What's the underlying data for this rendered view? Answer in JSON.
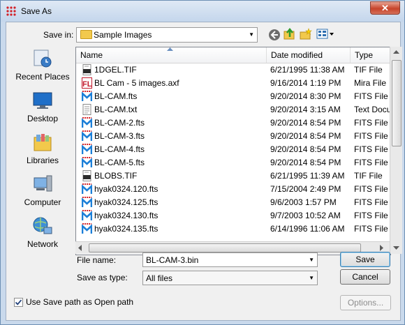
{
  "window": {
    "title": "Save As",
    "close_glyph": "✕"
  },
  "save_in": {
    "label": "Save in:",
    "value": "Sample Images"
  },
  "places": [
    {
      "label": "Recent Places",
      "icon": "recent-places-icon"
    },
    {
      "label": "Desktop",
      "icon": "desktop-icon"
    },
    {
      "label": "Libraries",
      "icon": "libraries-icon"
    },
    {
      "label": "Computer",
      "icon": "computer-icon"
    },
    {
      "label": "Network",
      "icon": "network-icon"
    }
  ],
  "columns": {
    "name": "Name",
    "date": "Date modified",
    "type": "Type"
  },
  "files": [
    {
      "name": "1DGEL.TIF",
      "date": "6/21/1995 11:38 AM",
      "type": "TIF File",
      "icon": "tif"
    },
    {
      "name": "BL Cam - 5 images.axf",
      "date": "9/16/2014 1:19 PM",
      "type": "Mira File",
      "icon": "axf"
    },
    {
      "name": "BL-CAM.fts",
      "date": "9/20/2014 8:30 PM",
      "type": "FITS File",
      "icon": "fits"
    },
    {
      "name": "BL-CAM.txt",
      "date": "9/20/2014 3:15 AM",
      "type": "Text Document",
      "icon": "txt"
    },
    {
      "name": "BL-CAM-2.fts",
      "date": "9/20/2014 8:54 PM",
      "type": "FITS File",
      "icon": "fits"
    },
    {
      "name": "BL-CAM-3.fts",
      "date": "9/20/2014 8:54 PM",
      "type": "FITS File",
      "icon": "fits"
    },
    {
      "name": "BL-CAM-4.fts",
      "date": "9/20/2014 8:54 PM",
      "type": "FITS File",
      "icon": "fits"
    },
    {
      "name": "BL-CAM-5.fts",
      "date": "9/20/2014 8:54 PM",
      "type": "FITS File",
      "icon": "fits"
    },
    {
      "name": "BLOBS.TIF",
      "date": "6/21/1995 11:39 AM",
      "type": "TIF File",
      "icon": "tif"
    },
    {
      "name": "hyak0324.120.fts",
      "date": "7/15/2004 2:49 PM",
      "type": "FITS File",
      "icon": "fits"
    },
    {
      "name": "hyak0324.125.fts",
      "date": "9/6/2003 1:57 PM",
      "type": "FITS File",
      "icon": "fits"
    },
    {
      "name": "hyak0324.130.fts",
      "date": "9/7/2003 10:52 AM",
      "type": "FITS File",
      "icon": "fits"
    },
    {
      "name": "hyak0324.135.fts",
      "date": "6/14/1996 11:06 AM",
      "type": "FITS File",
      "icon": "fits"
    }
  ],
  "file_name": {
    "label": "File name:",
    "value": "BL-CAM-3.bin"
  },
  "save_as_type": {
    "label": "Save as type:",
    "value": "All files"
  },
  "buttons": {
    "save": "Save",
    "cancel": "Cancel",
    "options": "Options..."
  },
  "option": {
    "label": "Use Save path as Open path",
    "checked": true
  }
}
